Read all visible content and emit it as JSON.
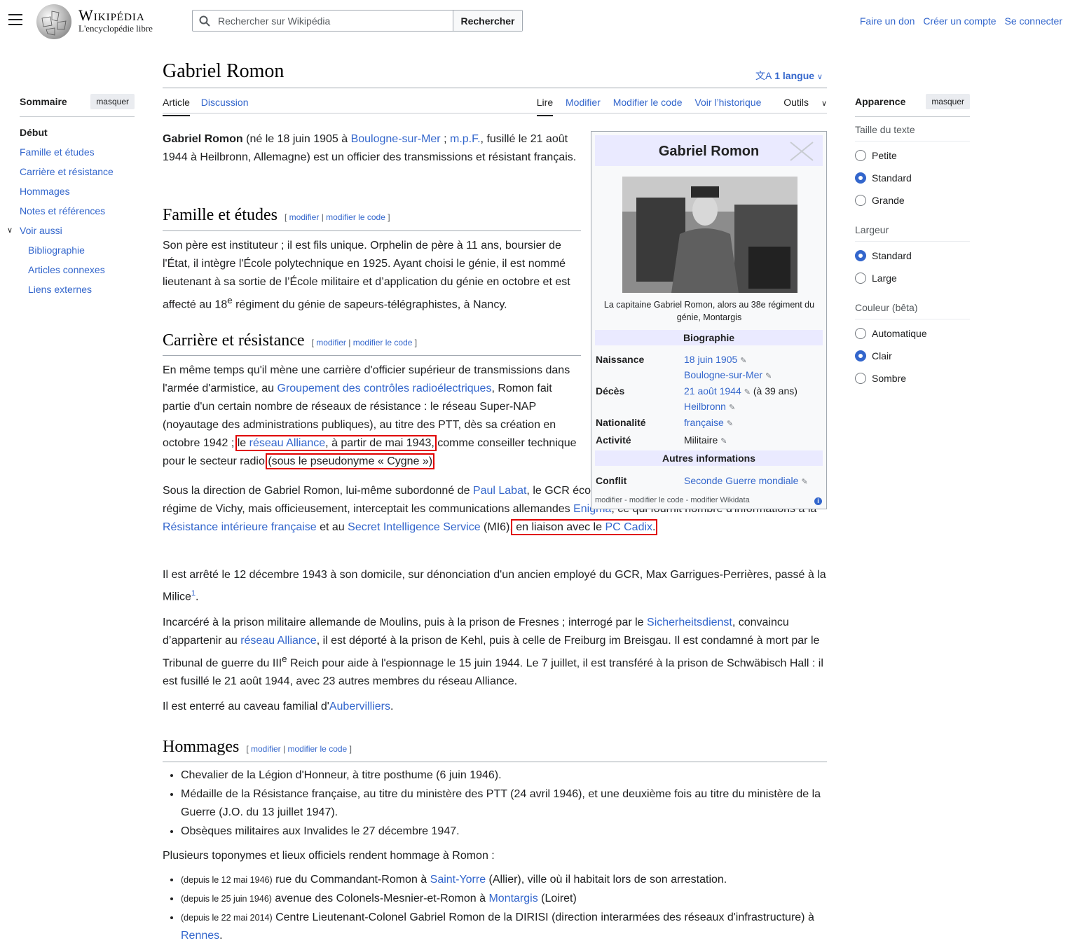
{
  "header": {
    "wordmark": "Wikipédia",
    "tagline": "L'encyclopédie libre",
    "search_placeholder": "Rechercher sur Wikipédia",
    "search_button": "Rechercher",
    "user_links": [
      "Faire un don",
      "Créer un compte",
      "Se connecter"
    ]
  },
  "toc": {
    "title": "Sommaire",
    "hide_label": "masquer",
    "items": [
      "Début",
      "Famille et études",
      "Carrière et résistance",
      "Hommages",
      "Notes et références",
      "Voir aussi"
    ],
    "subitems": [
      "Bibliographie",
      "Articles connexes",
      "Liens externes"
    ]
  },
  "page": {
    "title": "Gabriel Romon",
    "language_button": "1 langue",
    "tabs_left": [
      "Article",
      "Discussion"
    ],
    "tabs_right": [
      "Lire",
      "Modifier",
      "Modifier le code",
      "Voir l’historique",
      "Outils"
    ]
  },
  "edit_links": {
    "open": "[",
    "edit": "modifier",
    "sep": "|",
    "edit_code": "modifier le code",
    "close": "]"
  },
  "intro": {
    "bold": "Gabriel Romon",
    "t1": " (né le 18 juin 1905 à ",
    "l1": "Boulogne-sur-Mer",
    "t2": " ; ",
    "l2": "m.p.F.",
    "t3": ", fusillé le 21 août 1944 à Heilbronn, Allemagne) est un officier des transmissions et résistant français."
  },
  "sections": {
    "famille": {
      "heading": "Famille et études",
      "p1": "Son père est instituteur ; il est fils unique. Orphelin de père à 11 ans, boursier de l'État, il intègre l'École polytechnique en 1925. Ayant choisi le génie, il est nommé lieutenant à sa sortie de l’École militaire et d’application du génie en octobre et est affecté au 18",
      "sup": "e",
      "p1_end": " régiment du génie de sapeurs-télégraphistes, à Nancy."
    },
    "carriere": {
      "heading": "Carrière et résistance",
      "a1": "En même temps qu'il mène une carrière d'officier supérieur de transmissions dans l'armée d'armistice, au ",
      "a_l1": "Groupement des contrôles radioélectriques",
      "a2": ", Romon fait partie d'un certain nombre de réseaux de résistance : le réseau Super-NAP (noyautage des administrations publiques), au titre des PTT, dès sa création en octobre 1942 ; ",
      "a_hl1_pre": "le ",
      "a_hl1_link": "réseau Alliance",
      "a_hl1_post": ", à partir de mai 1943,",
      "a3": " comme conseiller technique pour le secteur radio ",
      "a_hl2": "(sous le pseudonyme « Cygne »)",
      "a4": ".",
      "b1": "Sous la direction de Gabriel Romon, lui-même subordonné de ",
      "b_l1": "Paul Labat",
      "b2": ", le GCR écoutait officiellement les communications pour le régime de Vichy, mais officieusement, interceptait les communications allemandes ",
      "b_l2": "Enigma",
      "b3": ", ce qui fournit nombre d'informations à la ",
      "b_l3": "Résistance intérieure française",
      "b4": " et au ",
      "b_l4": "Secret Intelligence Service",
      "b5": " (MI6),",
      "b_hl_pre": " en liaison avec le ",
      "b_hl_link": "PC Cadix",
      "b_hl_post": ".",
      "c1": "Il est arrêté le 12 décembre 1943 à son domicile, sur dénonciation d'un ancien employé du GCR, Max Garrigues-Perrières, passé à la Milice",
      "c_ref": "1",
      "c2": ".",
      "d1": "Incarcéré à la prison militaire allemande de Moulins, puis à la prison de Fresnes ; interrogé par le ",
      "d_l1": "Sicherheitsdienst",
      "d2": ", convaincu d’appartenir au ",
      "d_l2": "réseau Alliance",
      "d3": ", il est déporté à la prison de Kehl, puis à celle de Freiburg im Breisgau. Il est condamné à mort par le Tribunal de guerre du III",
      "d_sup": "e",
      "d4": " Reich pour aide à l'espionnage le 15 juin 1944. Le 7 juillet, il est transféré à la prison de Schwäbisch Hall : il est fusillé le 21 août 1944, avec 23 autres membres du réseau Alliance.",
      "e1": "Il est enterré au caveau familial d'",
      "e_l1": "Aubervilliers",
      "e2": "."
    },
    "hommages": {
      "heading": "Hommages",
      "bullets": [
        "Chevalier de la Légion d'Honneur, à titre posthume (6 juin 1946).",
        "Médaille de la Résistance française, au titre du ministère des PTT (24 avril 1946), et une deuxième fois au titre du ministère de la Guerre (J.O. du 13 juillet 1947).",
        "Obsèques militaires aux Invalides le 27 décembre 1947."
      ],
      "intro2": "Plusieurs toponymes et lieux officiels rendent hommage à Romon :",
      "places": [
        {
          "date": "(depuis le 12 mai 1946)",
          "t1": " rue du Commandant-Romon à ",
          "link": "Saint-Yorre",
          "t2": " (Allier), ville où il habitait lors de son arrestation."
        },
        {
          "date": "(depuis le 25 juin 1946)",
          "t1": " avenue des Colonels-Mesnier-et-Romon à ",
          "link": "Montargis",
          "t2": " (Loiret)"
        },
        {
          "date": "(depuis le 22 mai 2014)",
          "t1": " Centre Lieutenant-Colonel Gabriel Romon de la DIRISI (direction interarmées des réseaux d'infrastructure) à ",
          "link": "Rennes",
          "t2": "."
        }
      ]
    }
  },
  "infobox": {
    "title": "Gabriel Romon",
    "caption": "La capitaine Gabriel Romon, alors au 38e régiment du génie, Montargis",
    "section1": "Biographie",
    "naissance_label": "Naissance",
    "naissance_date": "18 juin 1905",
    "naissance_lieu": "Boulogne-sur-Mer",
    "deces_label": "Décès",
    "deces_date": "21 août 1944",
    "deces_age": " (à 39 ans)",
    "deces_lieu": "Heilbronn",
    "nationalite_label": "Nationalité",
    "nationalite": "française",
    "activite_label": "Activité",
    "activite": "Militaire",
    "section2": "Autres informations",
    "conflit_label": "Conflit",
    "conflit": "Seconde Guerre mondiale",
    "footer": "modifier - modifier le code - modifier Wikidata",
    "pencil": "✎",
    "info": "i"
  },
  "appearance": {
    "title": "Apparence",
    "hide_label": "masquer",
    "text_size_label": "Taille du texte",
    "text_size": [
      "Petite",
      "Standard",
      "Grande"
    ],
    "width_label": "Largeur",
    "width": [
      "Standard",
      "Large"
    ],
    "color_label": "Couleur (bêta)",
    "color": [
      "Automatique",
      "Clair",
      "Sombre"
    ]
  }
}
